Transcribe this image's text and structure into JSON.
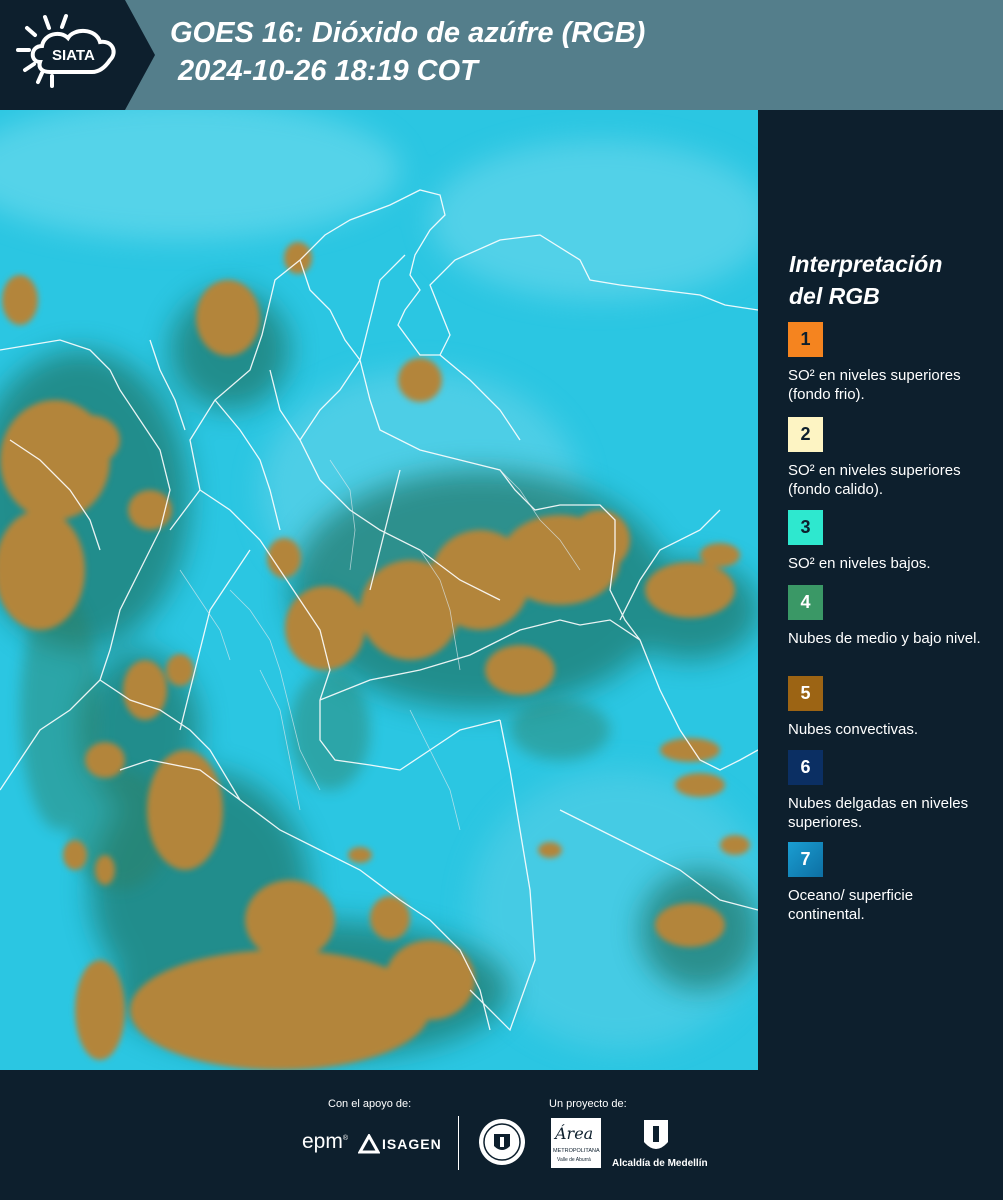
{
  "header": {
    "logo_text": "SIATA",
    "title_line1": "GOES 16: Dióxido de azúfre (RGB)",
    "title_line2": " 2024-10-26 18:19 COT"
  },
  "legend": {
    "title_line1": "Interpretación",
    "title_line2": "del RGB",
    "items": [
      {
        "num": "1",
        "color": "#f5841f",
        "text": "SO² en niveles superiores (fondo frio)."
      },
      {
        "num": "2",
        "color": "#fdf4c3",
        "text": "SO² en niveles superiores (fondo calido)."
      },
      {
        "num": "3",
        "color": "#2ee8cf",
        "text": "SO² en niveles bajos."
      },
      {
        "num": "4",
        "color": "#3a9866",
        "text": "Nubes de medio y bajo nivel."
      },
      {
        "num": "5",
        "color": "#9c6414",
        "text": "Nubes convectivas."
      },
      {
        "num": "6",
        "color": "#0b2f63",
        "text": "Nubes delgadas en niveles superiores."
      },
      {
        "num": "7",
        "color": "#1a9ed2",
        "text": "Oceano/ superficie continental."
      }
    ]
  },
  "footer": {
    "support_label": "Con el apoyo de:",
    "project_label": "Un proyecto de:",
    "epm": "epm",
    "isagen": "ISAGEN",
    "area_main": "Área",
    "area_sub1": "METROPOLITANA",
    "area_sub2": "Valle de Aburrá",
    "alcaldia": "Alcaldía de Medellín"
  },
  "colors": {
    "background": "#0d1f2d",
    "header": "#547e8b",
    "ocean_cyan": "#27c5e0",
    "convective_brown": "#b5853c"
  }
}
